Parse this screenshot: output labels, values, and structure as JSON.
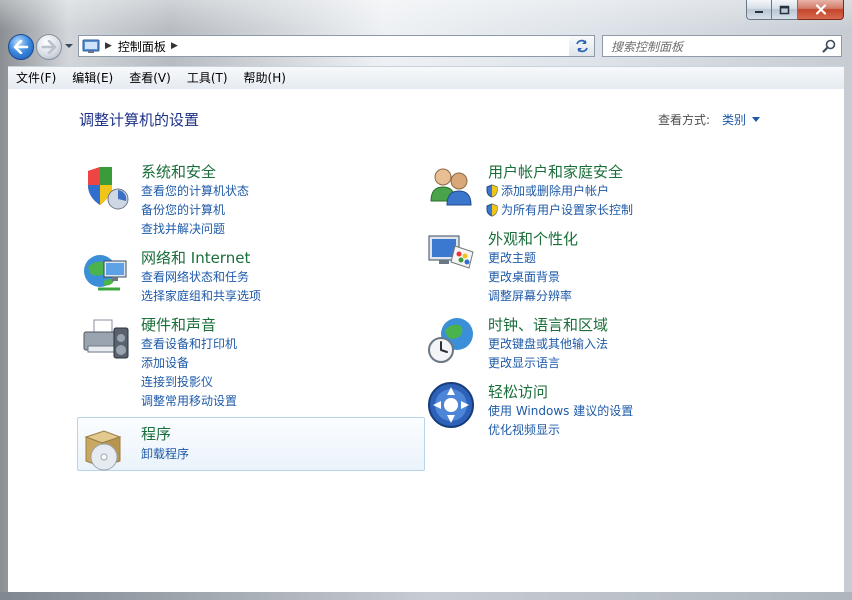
{
  "window": {
    "caption_buttons": {
      "minimize": "minimize-icon",
      "maximize": "maximize-icon",
      "close": "close-icon"
    }
  },
  "nav": {
    "breadcrumb": [
      "控制面板"
    ],
    "search_placeholder": "搜索控制面板"
  },
  "menu": [
    "文件(F)",
    "编辑(E)",
    "查看(V)",
    "工具(T)",
    "帮助(H)"
  ],
  "main": {
    "title": "调整计算机的设置",
    "view_by_label": "查看方式:",
    "view_by_value": "类别",
    "categories": [
      {
        "title": "系统和安全",
        "icon": "shield-security-icon",
        "links": [
          "查看您的计算机状态",
          "备份您的计算机",
          "查找并解决问题"
        ]
      },
      {
        "title": "网络和 Internet",
        "icon": "network-globe-icon",
        "links": [
          "查看网络状态和任务",
          "选择家庭组和共享选项"
        ]
      },
      {
        "title": "硬件和声音",
        "icon": "printer-speaker-icon",
        "links": [
          "查看设备和打印机",
          "添加设备",
          "连接到投影仪",
          "调整常用移动设置"
        ]
      },
      {
        "title": "程序",
        "icon": "programs-disc-icon",
        "links": [
          "卸载程序"
        ]
      },
      {
        "title": "用户帐户和家庭安全",
        "icon": "users-icon",
        "links": [
          "添加或删除用户帐户",
          "为所有用户设置家长控制"
        ]
      },
      {
        "title": "外观和个性化",
        "icon": "monitor-palette-icon",
        "links": [
          "更改主题",
          "更改桌面背景",
          "调整屏幕分辨率"
        ]
      },
      {
        "title": "时钟、语言和区域",
        "icon": "clock-globe-icon",
        "links": [
          "更改键盘或其他输入法",
          "更改显示语言"
        ]
      },
      {
        "title": "轻松访问",
        "icon": "ease-of-access-icon",
        "links": [
          "使用 Windows 建议的设置",
          "优化视频显示"
        ]
      }
    ]
  },
  "colors": {
    "link": "#1e5aa8",
    "category_title": "#1a6e3a",
    "page_title": "#1e3287"
  }
}
